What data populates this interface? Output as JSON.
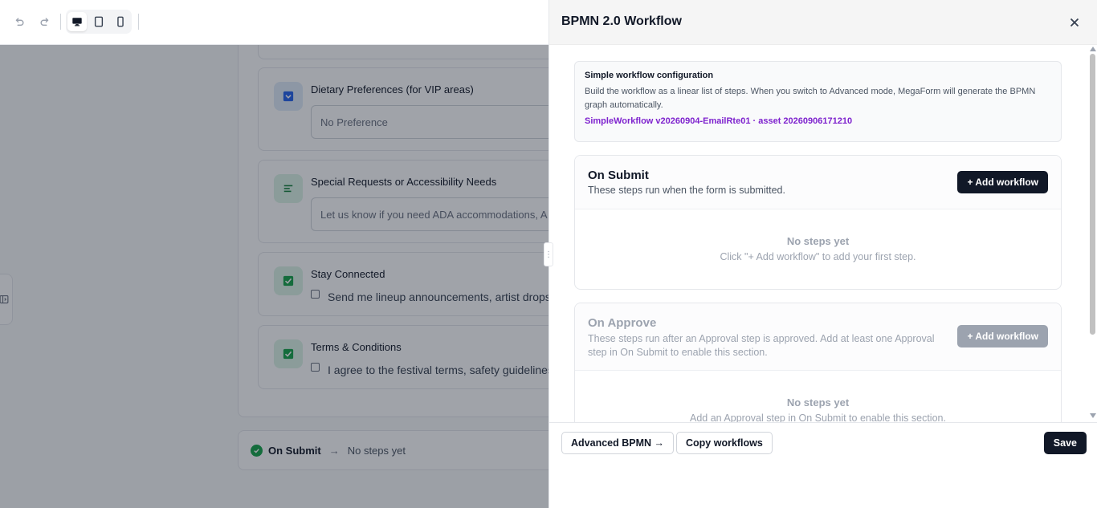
{
  "toolbar": {
    "undo_icon": "undo-icon",
    "redo_icon": "redo-icon",
    "devices": [
      "desktop-icon",
      "tablet-icon",
      "mobile-icon"
    ],
    "active_device": "desktop"
  },
  "form": {
    "fields": [
      {
        "label": "Dietary Preferences (for VIP areas)",
        "type": "select",
        "value": "No Preference",
        "icon": "dropdown-icon"
      },
      {
        "label": "Special Requests or Accessibility Needs",
        "type": "textarea",
        "placeholder": "Let us know if you need ADA accommodations, A",
        "icon": "text-lines-icon"
      },
      {
        "label": "Stay Connected",
        "type": "checkbox",
        "option": "Send me lineup announcements, artist drops,",
        "icon": "checkbox-icon"
      },
      {
        "label": "Terms & Conditions",
        "type": "checkbox",
        "option": "I agree to the festival terms, safety guidelines",
        "icon": "checkbox-icon"
      }
    ],
    "bottom_bar": {
      "title": "On Submit",
      "status": "No steps yet"
    }
  },
  "drawer": {
    "title": "BPMN 2.0 Workflow",
    "info": {
      "title": "Simple workflow configuration",
      "description": "Build the workflow as a linear list of steps. When you switch to Advanced mode, MegaForm will generate the BPMN graph automatically.",
      "asset": "SimpleWorkflow v20260904-EmailRte01 · asset 20260906171210"
    },
    "sections": [
      {
        "title": "On Submit",
        "description": "These steps run when the form is submitted.",
        "add_label": "+ Add workflow",
        "empty_title": "No steps yet",
        "empty_desc": "Click \"+ Add workflow\" to add your first step."
      },
      {
        "title": "On Approve",
        "description": "These steps run after an Approval step is approved. Add at least one Approval step in On Submit to enable this section.",
        "add_label": "+ Add workflow",
        "empty_title": "No steps yet",
        "empty_desc": "Add an Approval step in On Submit to enable this section."
      }
    ],
    "footer": {
      "advanced_label": "Advanced BPMN →",
      "copy_label": "Copy workflows",
      "save_label": "Save"
    }
  },
  "colors": {
    "primary": "#111827",
    "accent_purple": "#7e22ce",
    "success": "#16a34a",
    "disabled": "#9ca3af"
  }
}
